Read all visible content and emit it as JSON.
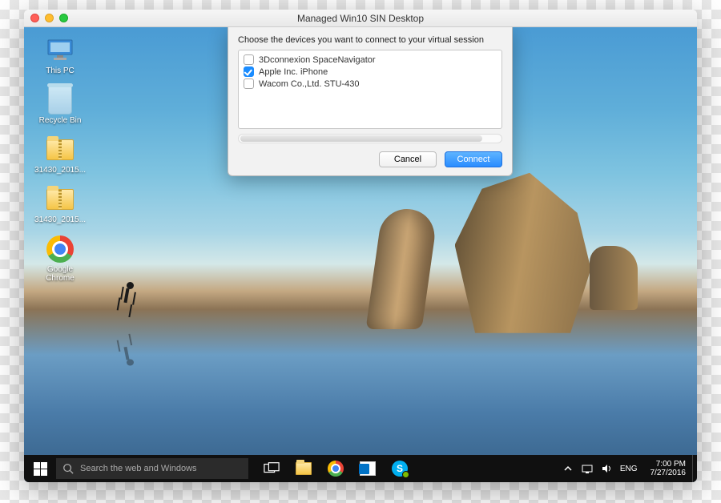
{
  "mac_window": {
    "title": "Managed Win10 SIN Desktop"
  },
  "desktop_icons": [
    {
      "id": "this-pc",
      "label": "This PC"
    },
    {
      "id": "recycle-bin",
      "label": "Recycle Bin"
    },
    {
      "id": "zip1",
      "label": "31430_2015..."
    },
    {
      "id": "zip2",
      "label": "31430_2015..."
    },
    {
      "id": "chrome",
      "label": "Google Chrome"
    }
  ],
  "dialog": {
    "prompt": "Choose the devices you want to connect to your virtual session",
    "devices": [
      {
        "name": "3Dconnexion SpaceNavigator",
        "checked": false
      },
      {
        "name": "Apple Inc. iPhone",
        "checked": true
      },
      {
        "name": "Wacom Co.,Ltd. STU-430",
        "checked": false
      }
    ],
    "cancel_label": "Cancel",
    "connect_label": "Connect"
  },
  "taskbar": {
    "search_placeholder": "Search the web and Windows",
    "lang": "ENG",
    "time": "7:00 PM",
    "date": "7/27/2016"
  }
}
